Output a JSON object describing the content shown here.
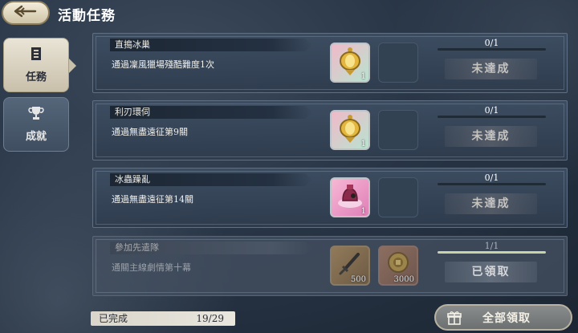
{
  "header": {
    "title": "活動任務"
  },
  "tabs": [
    {
      "label": "任務",
      "active": true
    },
    {
      "label": "成就",
      "active": false
    }
  ],
  "tasks": [
    {
      "name": "直搗冰巢",
      "desc": "通過凜風獵場殘酷難度1次",
      "progress": "0/1",
      "progress_fraction": 0,
      "status": "未達成",
      "rewards": [
        {
          "icon": "golden-lantern-icon",
          "qty": "1"
        }
      ]
    },
    {
      "name": "利刃環伺",
      "desc": "通過無盡遠征第9關",
      "progress": "0/1",
      "progress_fraction": 0,
      "status": "未達成",
      "rewards": [
        {
          "icon": "golden-lantern-icon",
          "qty": "1"
        }
      ]
    },
    {
      "name": "冰蟲躁亂",
      "desc": "通過無盡遠征第14關",
      "progress": "0/1",
      "progress_fraction": 0,
      "status": "未達成",
      "rewards": [
        {
          "icon": "pink-pot-icon",
          "qty": "1"
        }
      ]
    },
    {
      "name": "參加先遣隊",
      "desc": "通關主線劇情第十幕",
      "progress": "1/1",
      "progress_fraction": 1,
      "status": "已領取",
      "rewards": [
        {
          "icon": "sword-icon",
          "qty": "500"
        },
        {
          "icon": "coin-icon",
          "qty": "3000"
        }
      ]
    }
  ],
  "footer": {
    "completed_label": "已完成",
    "completed_value": "19/29",
    "claim_all": "全部領取"
  },
  "colors": {
    "accent": "#c9c0aa",
    "panel": "#3e4e62"
  }
}
